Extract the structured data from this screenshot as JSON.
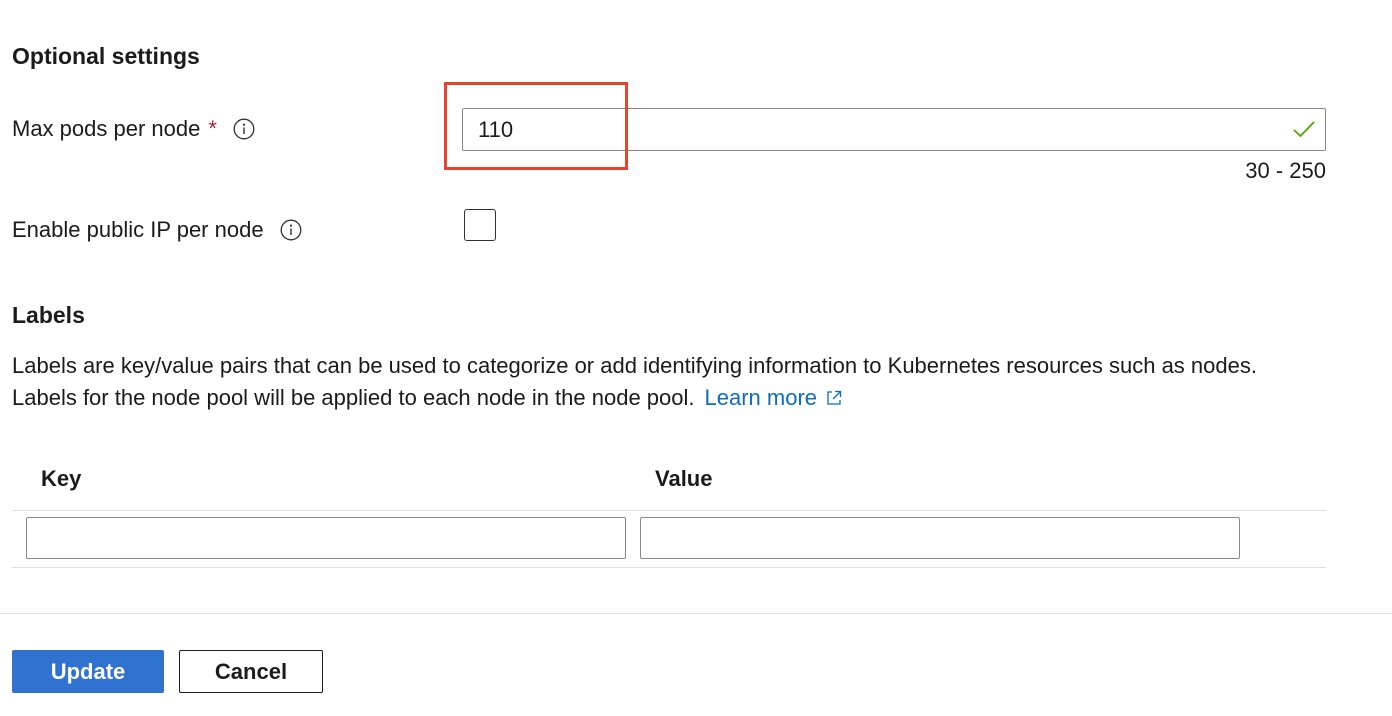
{
  "optional_settings": {
    "title": "Optional settings",
    "max_pods": {
      "label": "Max pods per node",
      "required_mark": "*",
      "info_icon": "info-icon",
      "value": "110",
      "valid_icon": "checkmark-icon",
      "range_hint": "30 - 250"
    },
    "public_ip": {
      "label": "Enable public IP per node",
      "info_icon": "info-icon",
      "checked": false
    }
  },
  "labels": {
    "title": "Labels",
    "description_line1": "Labels are key/value pairs that can be used to categorize or add identifying information to Kubernetes resources such as nodes.",
    "description_line2": "Labels for the node pool will be applied to each node in the node pool.",
    "learn_more": "Learn more",
    "learn_more_icon": "external-link-icon",
    "table": {
      "key_header": "Key",
      "value_header": "Value",
      "rows": [
        {
          "key": "",
          "value": ""
        }
      ]
    }
  },
  "footer": {
    "update_label": "Update",
    "cancel_label": "Cancel"
  },
  "colors": {
    "primary": "#2f72d0",
    "link": "#0f6cbd",
    "required": "#a4262c",
    "valid": "#57a300",
    "highlight": "#e8432b"
  }
}
